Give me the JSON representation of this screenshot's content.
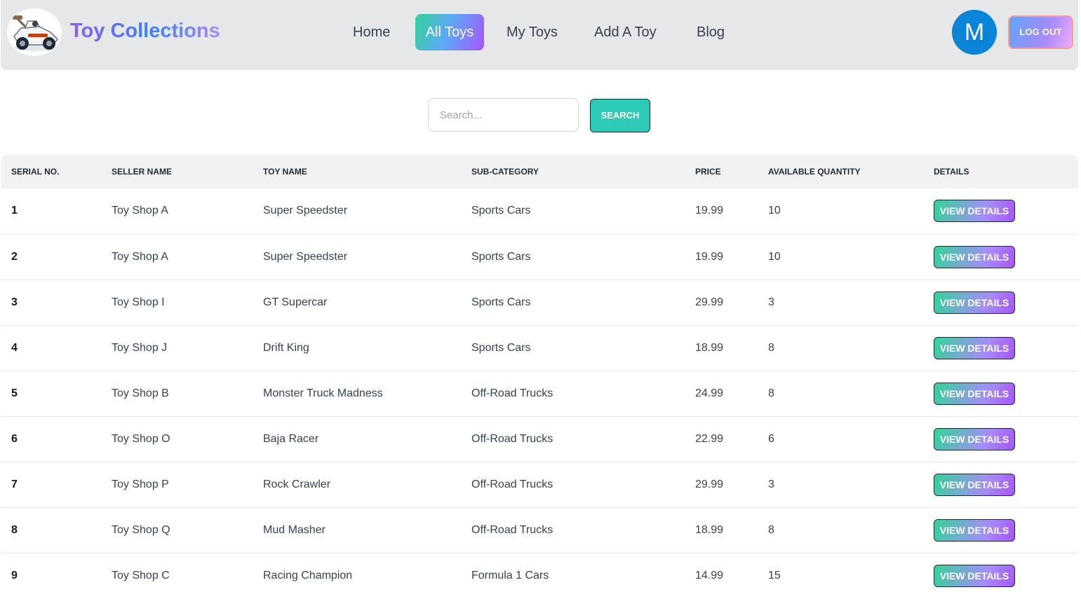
{
  "header": {
    "brand": "Toy Collections",
    "logo_icon": "race-car-icon",
    "nav": [
      {
        "label": "Home",
        "active": false
      },
      {
        "label": "All Toys",
        "active": true
      },
      {
        "label": "My Toys",
        "active": false
      },
      {
        "label": "Add A Toy",
        "active": false
      },
      {
        "label": "Blog",
        "active": false
      }
    ],
    "avatar_initial": "M",
    "logout_label": "LOG OUT"
  },
  "search": {
    "placeholder": "Search...",
    "value": "",
    "button_label": "SEARCH"
  },
  "table": {
    "columns": [
      "SERIAL NO.",
      "SELLER NAME",
      "TOY NAME",
      "SUB-CATEGORY",
      "PRICE",
      "AVAILABLE QUANTITY",
      "DETAILS"
    ],
    "details_label": "VIEW DETAILS",
    "rows": [
      {
        "serial": "1",
        "seller": "Toy Shop A",
        "toy": "Super Speedster",
        "category": "Sports Cars",
        "price": "19.99",
        "qty": "10"
      },
      {
        "serial": "2",
        "seller": "Toy Shop A",
        "toy": "Super Speedster",
        "category": "Sports Cars",
        "price": "19.99",
        "qty": "10"
      },
      {
        "serial": "3",
        "seller": "Toy Shop I",
        "toy": "GT Supercar",
        "category": "Sports Cars",
        "price": "29.99",
        "qty": "3"
      },
      {
        "serial": "4",
        "seller": "Toy Shop J",
        "toy": "Drift King",
        "category": "Sports Cars",
        "price": "18.99",
        "qty": "8"
      },
      {
        "serial": "5",
        "seller": "Toy Shop B",
        "toy": "Monster Truck Madness",
        "category": "Off-Road Trucks",
        "price": "24.99",
        "qty": "8"
      },
      {
        "serial": "6",
        "seller": "Toy Shop O",
        "toy": "Baja Racer",
        "category": "Off-Road Trucks",
        "price": "22.99",
        "qty": "6"
      },
      {
        "serial": "7",
        "seller": "Toy Shop P",
        "toy": "Rock Crawler",
        "category": "Off-Road Trucks",
        "price": "29.99",
        "qty": "3"
      },
      {
        "serial": "8",
        "seller": "Toy Shop Q",
        "toy": "Mud Masher",
        "category": "Off-Road Trucks",
        "price": "18.99",
        "qty": "8"
      },
      {
        "serial": "9",
        "seller": "Toy Shop C",
        "toy": "Racing Champion",
        "category": "Formula 1 Cars",
        "price": "14.99",
        "qty": "15"
      }
    ]
  }
}
